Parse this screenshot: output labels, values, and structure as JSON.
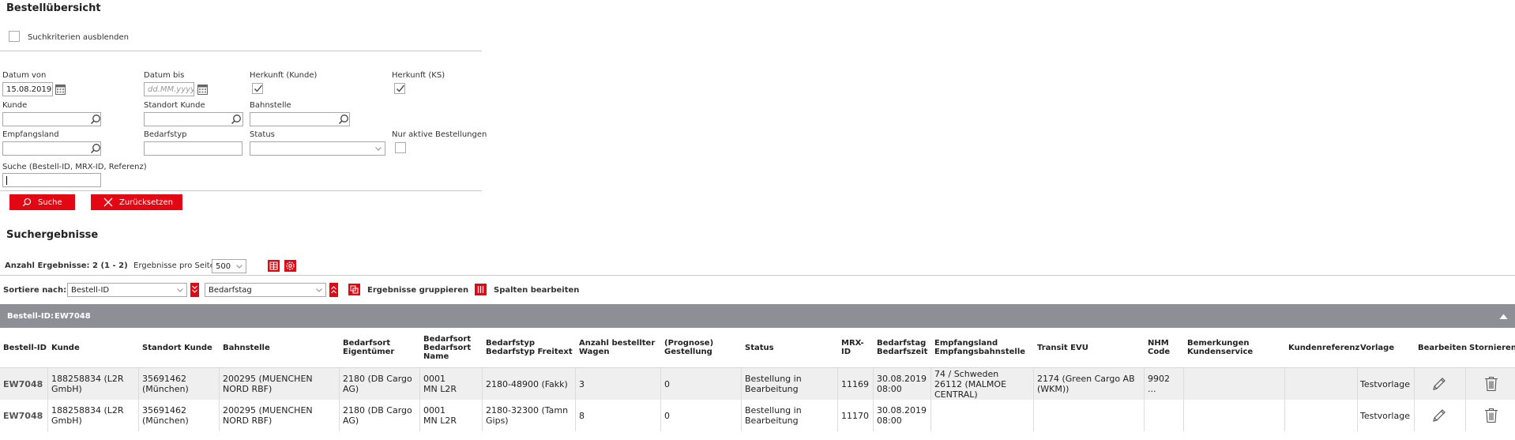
{
  "page_title": "Bestellübersicht",
  "hide_criteria_label": "Suchkriterien ausblenden",
  "filters": {
    "datum_von_label": "Datum von",
    "datum_von_value": "15.08.2019",
    "datum_bis_label": "Datum bis",
    "datum_bis_placeholder": "dd.MM.yyyy",
    "herkunft_kunde_label": "Herkunft (Kunde)",
    "herkunft_ks_label": "Herkunft (KS)",
    "kunde_label": "Kunde",
    "standort_kunde_label": "Standort Kunde",
    "bahnstelle_label": "Bahnstelle",
    "empfangsland_label": "Empfangsland",
    "bedarfstyp_label": "Bedarfstyp",
    "status_label": "Status",
    "nur_aktive_label": "Nur aktive Bestellungen",
    "suche_label": "Suche (Bestell-ID, MRX-ID, Referenz)"
  },
  "buttons": {
    "suche": "Suche",
    "zuruecksetzen": "Zurücksetzen"
  },
  "results": {
    "title": "Suchergebnisse",
    "count": "Anzahl Ergebnisse: 2 (1 - 2)",
    "per_page_label": "Ergebnisse pro Seite:",
    "per_page_value": "500"
  },
  "sort": {
    "label": "Sortiere nach:",
    "field1": "Bestell-ID",
    "field2": "Bedarfstag",
    "group_label": "Ergebnisse gruppieren",
    "columns_label": "Spalten bearbeiten"
  },
  "group": {
    "label": "Bestell-ID:",
    "value": "EW7048"
  },
  "columns": [
    [
      "Bestell-ID"
    ],
    [
      "Kunde"
    ],
    [
      "Standort Kunde"
    ],
    [
      "Bahnstelle"
    ],
    [
      "Bedarfsort",
      "Eigentümer"
    ],
    [
      "Bedarfsort",
      "Bedarfsort",
      "Name"
    ],
    [
      "Bedarfstyp",
      "Bedarfstyp Freitext"
    ],
    [
      "Anzahl bestellter",
      "Wagen"
    ],
    [
      "(Prognose)",
      "Gestellung"
    ],
    [
      "Status"
    ],
    [
      "MRX-",
      "ID"
    ],
    [
      "Bedarfstag",
      "Bedarfszeit"
    ],
    [
      "Empfangsland",
      "Empfangsbahnstelle"
    ],
    [
      "Transit EVU"
    ],
    [
      "NHM",
      "Code"
    ],
    [
      "Bemerkungen",
      "Kundenservice"
    ],
    [
      "Kundenreferenz"
    ],
    [
      "Vorlage"
    ],
    [
      "Bearbeiten"
    ],
    [
      "Stornieren"
    ]
  ],
  "rows": [
    {
      "bestell_id": "EW7048",
      "kunde": [
        "188258834 (L2R",
        "GmbH)"
      ],
      "standort": [
        "35691462",
        "(München)"
      ],
      "bahnstelle": [
        "200295 (MUENCHEN",
        "NORD RBF)"
      ],
      "eigentuemer": [
        "2180 (DB Cargo",
        "AG)"
      ],
      "bedarfsort": [
        "0001",
        "MN L2R"
      ],
      "bedarfstyp": [
        "2180-48900 (Fakk)"
      ],
      "anzahl": "3",
      "prognose": "0",
      "status": [
        "Bestellung in",
        "Bearbeitung"
      ],
      "mrx": "11169",
      "bedarfstag": [
        "30.08.2019",
        "08:00"
      ],
      "empfang": [
        "74 / Schweden",
        "26112 (MALMOE",
        "CENTRAL)"
      ],
      "transit": [
        "2174 (Green Cargo AB",
        "(WKM))"
      ],
      "nhm": [
        "9902",
        "..."
      ],
      "vorlage": "Testvorlage"
    },
    {
      "bestell_id": "EW7048",
      "kunde": [
        "188258834 (L2R",
        "GmbH)"
      ],
      "standort": [
        "35691462",
        "(München)"
      ],
      "bahnstelle": [
        "200295 (MUENCHEN",
        "NORD RBF)"
      ],
      "eigentuemer": [
        "2180 (DB Cargo",
        "AG)"
      ],
      "bedarfsort": [
        "0001",
        "MN L2R"
      ],
      "bedarfstyp": [
        "2180-32300 (Tamn",
        "Gips)"
      ],
      "anzahl": "8",
      "prognose": "0",
      "status": [
        "Bestellung in",
        "Bearbeitung"
      ],
      "mrx": "11170",
      "bedarfstag": [
        "30.08.2019",
        "08:00"
      ],
      "empfang": [],
      "transit": [],
      "nhm": [],
      "vorlage": "Testvorlage"
    }
  ],
  "colors": {
    "accent": "#e30613",
    "groupbar": "#8c8f96"
  }
}
